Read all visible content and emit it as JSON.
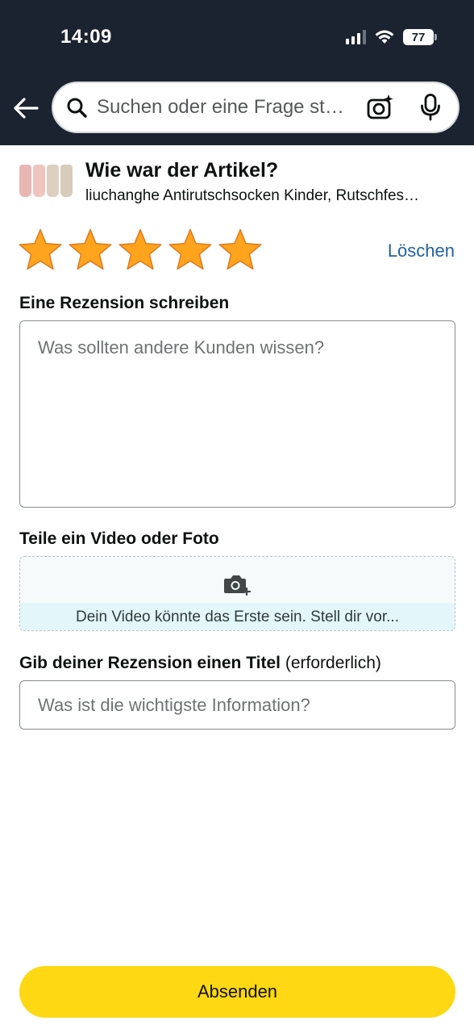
{
  "status_bar": {
    "time": "14:09",
    "battery": "77",
    "icons": [
      "signal-icon",
      "wifi-icon",
      "battery-icon"
    ]
  },
  "header": {
    "back_icon": "back-arrow-icon",
    "search": {
      "placeholder": "Suchen oder eine Frage st…",
      "icons": [
        "search-icon",
        "camera-sparkle-icon",
        "microphone-icon"
      ]
    }
  },
  "product": {
    "heading": "Wie war der Artikel?",
    "name": "liuchanghe Antirutschsocken Kinder, Rutschfes…"
  },
  "rating": {
    "value": 5,
    "max": 5,
    "clear_label": "Löschen"
  },
  "review": {
    "label": "Eine Rezension schreiben",
    "placeholder": "Was sollten andere Kunden wissen?",
    "value": ""
  },
  "media": {
    "label": "Teile ein Video oder Foto",
    "hint": "Dein Video könnte das Erste sein. Stell dir vor..."
  },
  "title_field": {
    "label": "Gib deiner Rezension einen Titel",
    "label_suffix": "(erforderlich)",
    "placeholder": "Was ist die wichtigste Information?",
    "value": ""
  },
  "submit_label": "Absenden",
  "colors": {
    "header_bg": "#1b2330",
    "star": "#ffa41c",
    "link": "#2162a1",
    "submit_bg": "#ffd814",
    "hint_bg": "#e3f7fb"
  }
}
